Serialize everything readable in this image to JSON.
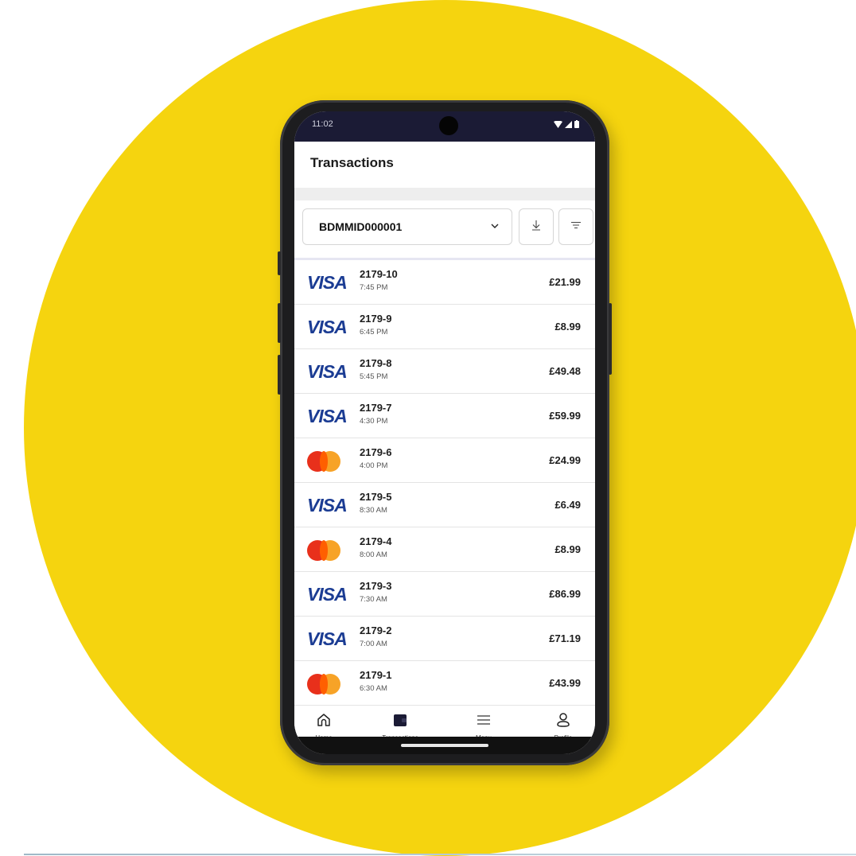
{
  "status_bar": {
    "time": "11:02"
  },
  "header": {
    "title": "Transactions"
  },
  "filter": {
    "selected_merchant": "BDMMID000001"
  },
  "transactions": [
    {
      "card": "visa",
      "card_label": "VISA",
      "ref": "2179-10",
      "time": "7:45 PM",
      "amount": "£21.99"
    },
    {
      "card": "visa",
      "card_label": "VISA",
      "ref": "2179-9",
      "time": "6:45 PM",
      "amount": "£8.99"
    },
    {
      "card": "visa",
      "card_label": "VISA",
      "ref": "2179-8",
      "time": "5:45 PM",
      "amount": "£49.48"
    },
    {
      "card": "visa",
      "card_label": "VISA",
      "ref": "2179-7",
      "time": "4:30 PM",
      "amount": "£59.99"
    },
    {
      "card": "mastercard",
      "card_label": "",
      "ref": "2179-6",
      "time": "4:00 PM",
      "amount": "£24.99"
    },
    {
      "card": "visa",
      "card_label": "VISA",
      "ref": "2179-5",
      "time": "8:30 AM",
      "amount": "£6.49"
    },
    {
      "card": "mastercard",
      "card_label": "",
      "ref": "2179-4",
      "time": "8:00 AM",
      "amount": "£8.99"
    },
    {
      "card": "visa",
      "card_label": "VISA",
      "ref": "2179-3",
      "time": "7:30 AM",
      "amount": "£86.99"
    },
    {
      "card": "visa",
      "card_label": "VISA",
      "ref": "2179-2",
      "time": "7:00 AM",
      "amount": "£71.19"
    },
    {
      "card": "mastercard",
      "card_label": "",
      "ref": "2179-1",
      "time": "6:30 AM",
      "amount": "£43.99"
    }
  ],
  "bottom_nav": [
    {
      "label": "Home",
      "icon": "home-icon",
      "active": false
    },
    {
      "label": "Transactions",
      "icon": "wallet-icon",
      "active": true
    },
    {
      "label": "Menu",
      "icon": "menu-icon",
      "active": false
    },
    {
      "label": "Profile",
      "icon": "profile-icon",
      "active": false
    }
  ],
  "colors": {
    "background_circle": "#f5d40f",
    "status_bar": "#1b1b35",
    "visa_blue": "#1b3c93",
    "mastercard_red": "#e8301b",
    "mastercard_orange": "#f79e1b"
  }
}
